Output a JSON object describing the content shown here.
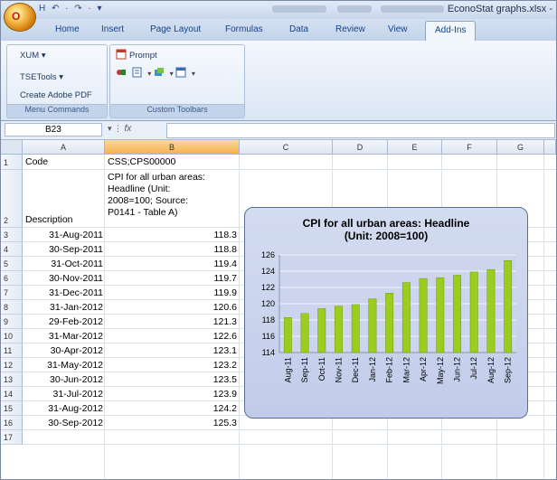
{
  "window": {
    "title": "EconoStat graphs.xlsx -",
    "office_button_glyph": "O",
    "quick_access": "H ↶ · ↷ · ▾"
  },
  "tabs": [
    {
      "label": "Home"
    },
    {
      "label": "Insert"
    },
    {
      "label": "Page Layout"
    },
    {
      "label": "Formulas"
    },
    {
      "label": "Data"
    },
    {
      "label": "Review"
    },
    {
      "label": "View"
    },
    {
      "label": "Add-Ins"
    }
  ],
  "ribbon": {
    "menu_commands": {
      "items": [
        "XUM ▾",
        "TSETools ▾",
        "Create Adobe PDF"
      ],
      "label": "Menu Commands"
    },
    "custom_toolbars": {
      "prompt_label": "Prompt",
      "label": "Custom Toolbars"
    }
  },
  "formula_bar": {
    "name_box": "B23",
    "fx": "fx",
    "value": ""
  },
  "sheet": {
    "columns": [
      "A",
      "B",
      "C",
      "D",
      "E",
      "F",
      "G"
    ],
    "row_numbers": [
      "1",
      "2",
      "3",
      "4",
      "5",
      "6",
      "7",
      "8",
      "9",
      "10",
      "11",
      "12",
      "13",
      "14",
      "15",
      "16",
      "17"
    ],
    "a1": "Code",
    "b1": "CSS;CPS00000",
    "a2": "Description",
    "b2_lines": [
      "CPI for all urban areas:",
      "Headline (Unit:",
      "2008=100; Source:",
      "P0141 - Table A)"
    ],
    "rows": [
      {
        "date": "31-Aug-2011",
        "value": "118.3"
      },
      {
        "date": "30-Sep-2011",
        "value": "118.8"
      },
      {
        "date": "31-Oct-2011",
        "value": "119.4"
      },
      {
        "date": "30-Nov-2011",
        "value": "119.7"
      },
      {
        "date": "31-Dec-2011",
        "value": "119.9"
      },
      {
        "date": "31-Jan-2012",
        "value": "120.6"
      },
      {
        "date": "29-Feb-2012",
        "value": "121.3"
      },
      {
        "date": "31-Mar-2012",
        "value": "122.6"
      },
      {
        "date": "30-Apr-2012",
        "value": "123.1"
      },
      {
        "date": "31-May-2012",
        "value": "123.2"
      },
      {
        "date": "30-Jun-2012",
        "value": "123.5"
      },
      {
        "date": "31-Jul-2012",
        "value": "123.9"
      },
      {
        "date": "31-Aug-2012",
        "value": "124.2"
      },
      {
        "date": "30-Sep-2012",
        "value": "125.3"
      }
    ]
  },
  "chart_data": {
    "type": "bar",
    "title_lines": [
      "CPI for all urban areas: Headline",
      "(Unit: 2008=100)"
    ],
    "categories": [
      "Aug-11",
      "Sep-11",
      "Oct-11",
      "Nov-11",
      "Dec-11",
      "Jan-12",
      "Feb-12",
      "Mar-12",
      "Apr-12",
      "May-12",
      "Jun-12",
      "Jul-12",
      "Aug-12",
      "Sep-12"
    ],
    "values": [
      118.3,
      118.8,
      119.4,
      119.7,
      119.9,
      120.6,
      121.3,
      122.6,
      123.1,
      123.2,
      123.5,
      123.9,
      124.2,
      125.3
    ],
    "ylim": [
      114,
      126
    ],
    "yticks": [
      "114",
      "116",
      "118",
      "120",
      "122",
      "124",
      "126"
    ],
    "grid": true,
    "legend": "none",
    "colors": {
      "bar": "#9acd1e",
      "bar_edge": "#6f9a10",
      "background": "#c8d1ec"
    }
  }
}
